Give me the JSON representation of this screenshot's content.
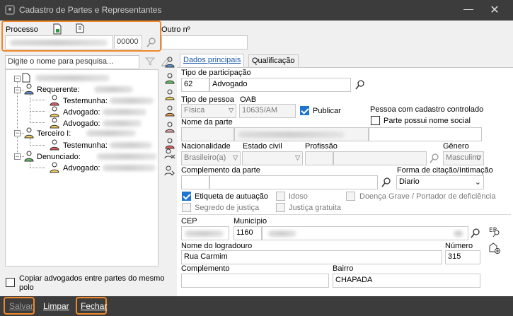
{
  "window": {
    "title": "Cadastro de Partes e Representantes"
  },
  "processo": {
    "label": "Processo",
    "number_suffix": "00000",
    "outro_label": "Outro nº"
  },
  "left": {
    "search_placeholder": "Digite o nome para pesquisa...",
    "tree": {
      "root_label": "",
      "nodes": [
        {
          "label": "Requerente:"
        },
        {
          "label": "Testemunha:"
        },
        {
          "label": "Advogado:"
        },
        {
          "label": "Advogado:"
        },
        {
          "label": "Terceiro I:"
        },
        {
          "label": "Testemunha:"
        },
        {
          "label": "Denunciado:"
        },
        {
          "label": "Advogado:"
        }
      ]
    },
    "copy_checkbox_label": "Copiar advogados entre partes do mesmo polo"
  },
  "tabs": [
    {
      "label": "Dados principais",
      "active": true
    },
    {
      "label": "Qualificação",
      "active": false
    }
  ],
  "form": {
    "tipo_participacao_label": "Tipo de participação",
    "tipo_participacao_code": "62",
    "tipo_participacao_value": "Advogado",
    "tipo_pessoa_label": "Tipo de pessoa",
    "tipo_pessoa_value": "Física",
    "oab_label": "OAB",
    "oab_value": "10635/AM",
    "publicar_label": "Publicar",
    "pessoa_controlado_label": "Pessoa com cadastro controlado",
    "nome_social_label": "Parte possui nome social",
    "nome_parte_label": "Nome da parte",
    "nacionalidade_label": "Nacionalidade",
    "nacionalidade_value": "Brasileiro(a)",
    "estado_civil_label": "Estado civil",
    "profissao_label": "Profissão",
    "genero_label": "Gênero",
    "genero_value": "Masculino",
    "complemento_parte_label": "Complemento da parte",
    "forma_citacao_label": "Forma de citação/Intimação",
    "forma_citacao_value": "Diario",
    "etiqueta_label": "Etiqueta de autuação",
    "idoso_label": "Idoso",
    "doenca_label": "Doença Grave / Portador de deficiência",
    "segredo_label": "Segredo de justiça",
    "justica_gratuita_label": "Justiça gratuita",
    "cep_label": "CEP",
    "municipio_label": "Município",
    "municipio_code": "1160",
    "logradouro_label": "Nome do logradouro",
    "logradouro_value": "Rua Carmim",
    "numero_label": "Número",
    "numero_value": "315",
    "complemento_label": "Complemento",
    "bairro_label": "Bairro",
    "bairro_value": "CHAPADA"
  },
  "footer": {
    "salvar": "Salvar",
    "limpar": "Limpar",
    "fechar": "Fechar"
  },
  "colors": {
    "accent": "#1e74d0",
    "highlight": "#f0882a",
    "titlebar": "#3c3c3c"
  }
}
